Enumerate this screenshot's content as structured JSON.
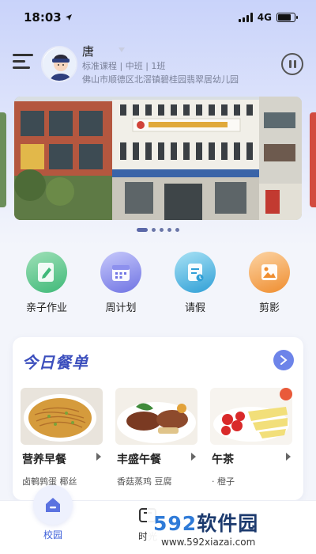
{
  "status_bar": {
    "time": "18:03",
    "network": "4G",
    "battery_level": 0.8
  },
  "user": {
    "name": "唐",
    "class_info": "标准课程 | 中班 | 1班",
    "school": "佛山市顺德区北滘镇碧桂园翡翠居幼儿园"
  },
  "header": {
    "menu_icon": "menu-icon",
    "message_icon": "message-icon"
  },
  "banner": {
    "active_index": 0,
    "dot_count": 5
  },
  "quick_actions": [
    {
      "label": "亲子作业",
      "icon": "homework-icon",
      "color": "#4fc08a"
    },
    {
      "label": "周计划",
      "icon": "calendar-icon",
      "color": "#7b7ee8"
    },
    {
      "label": "请假",
      "icon": "leave-form-icon",
      "color": "#3ba7d9"
    },
    {
      "label": "剪影",
      "icon": "photo-icon",
      "color": "#f39a3a"
    }
  ],
  "today_menu": {
    "title": "今日餐单",
    "meals": [
      {
        "name": "营养早餐",
        "desc": "卤鹌鹑蛋  椰丝"
      },
      {
        "name": "丰盛午餐",
        "desc": "香菇蒸鸡  豆腐"
      },
      {
        "name": "午茶",
        "desc": "· 橙子"
      }
    ]
  },
  "tabbar": {
    "tabs": [
      {
        "label": "校园",
        "active": true
      },
      {
        "label": "时光",
        "active": false
      }
    ]
  },
  "watermark": {
    "logo_digits": "592",
    "logo_text": "软件园",
    "url": "www.592xiazai.com"
  },
  "colors": {
    "accent": "#3c4fbd",
    "tab_active": "#3c5fd9"
  }
}
